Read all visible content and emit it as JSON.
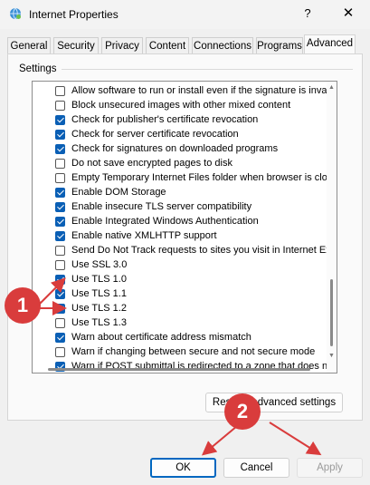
{
  "window": {
    "title": "Internet Properties",
    "help_glyph": "?",
    "close_glyph": "✕"
  },
  "tabs": [
    {
      "label": "General"
    },
    {
      "label": "Security"
    },
    {
      "label": "Privacy"
    },
    {
      "label": "Content"
    },
    {
      "label": "Connections"
    },
    {
      "label": "Programs"
    },
    {
      "label": "Advanced",
      "active": true
    }
  ],
  "settings": {
    "group_label": "Settings",
    "items": [
      {
        "label": "Allow software to run or install even if the signature is invalid",
        "checked": false
      },
      {
        "label": "Block unsecured images with other mixed content",
        "checked": false
      },
      {
        "label": "Check for publisher's certificate revocation",
        "checked": true
      },
      {
        "label": "Check for server certificate revocation",
        "checked": true
      },
      {
        "label": "Check for signatures on downloaded programs",
        "checked": true
      },
      {
        "label": "Do not save encrypted pages to disk",
        "checked": false
      },
      {
        "label": "Empty Temporary Internet Files folder when browser is closed",
        "checked": false
      },
      {
        "label": "Enable DOM Storage",
        "checked": true
      },
      {
        "label": "Enable insecure TLS server compatibility",
        "checked": true
      },
      {
        "label": "Enable Integrated Windows Authentication",
        "checked": true
      },
      {
        "label": "Enable native XMLHTTP support",
        "checked": true
      },
      {
        "label": "Send Do Not Track requests to sites you visit in Internet Explorer",
        "checked": false
      },
      {
        "label": "Use SSL 3.0",
        "checked": false
      },
      {
        "label": "Use TLS 1.0",
        "checked": true
      },
      {
        "label": "Use TLS 1.1",
        "checked": true
      },
      {
        "label": "Use TLS 1.2",
        "checked": true
      },
      {
        "label": "Use TLS 1.3",
        "checked": false
      },
      {
        "label": "Warn about certificate address mismatch",
        "checked": true
      },
      {
        "label": "Warn if changing between secure and not secure mode",
        "checked": false
      },
      {
        "label": "Warn if POST submittal is redirected to a zone that does not permit posts",
        "checked": true
      }
    ]
  },
  "buttons": {
    "restore_label": "Restore advanced settings",
    "ok_label": "OK",
    "cancel_label": "Cancel",
    "apply_label": "Apply"
  },
  "annotations": {
    "badge_1": "1",
    "badge_2": "2",
    "color": "#d93c3c"
  },
  "colors": {
    "accent": "#0067c0",
    "checkbox": "#0a5fb5"
  }
}
